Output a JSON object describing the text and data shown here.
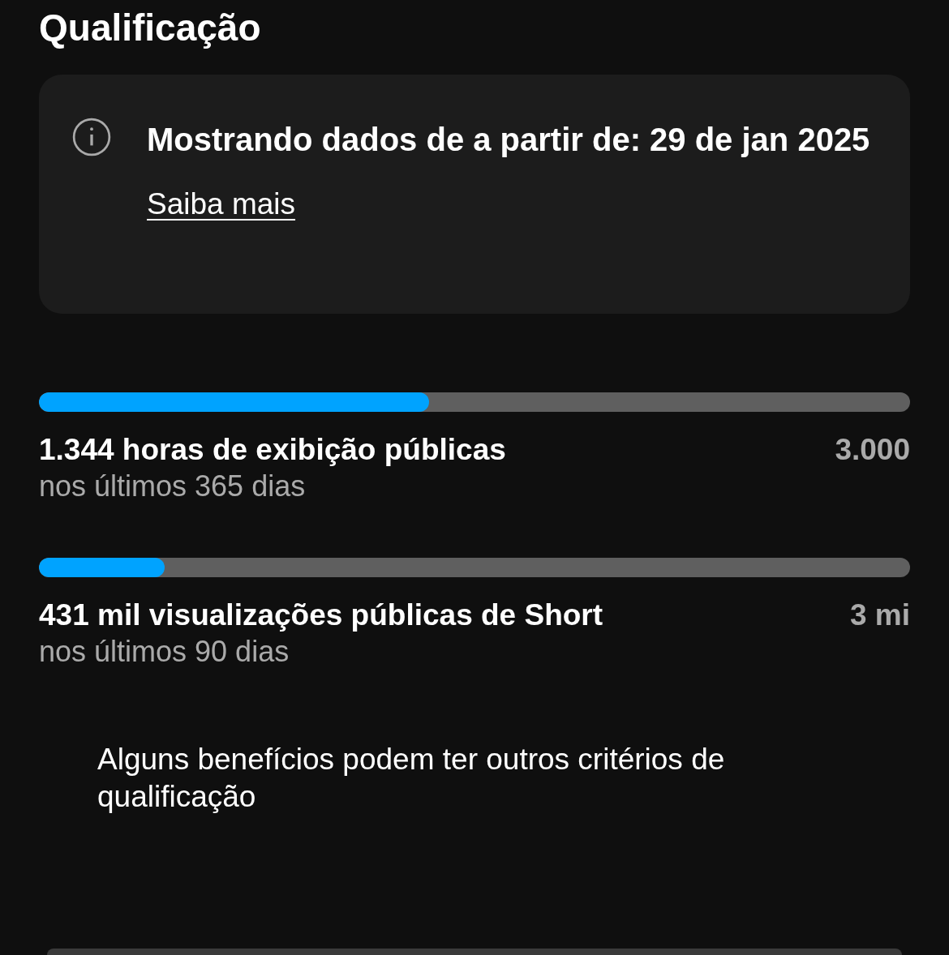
{
  "title": "Qualificação",
  "notice": {
    "text": "Mostrando dados de a partir de: 29 de jan 2025",
    "link": "Saiba mais"
  },
  "metrics": [
    {
      "label": "1.344 horas de exibição públicas",
      "target": "3.000",
      "period": "nos últimos 365 dias",
      "level": 0.448
    },
    {
      "label": "431 mil visualizações públicas de Short",
      "target": "3 mi",
      "period": "nos últimos 90 dias",
      "level": 0.144
    }
  ],
  "note": "Alguns benefícios podem ter outros critérios de qualificação"
}
